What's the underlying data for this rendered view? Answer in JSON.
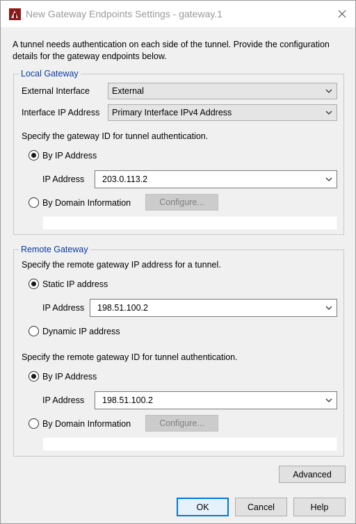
{
  "window": {
    "title": "New Gateway Endpoints Settings - gateway.1",
    "app_icon": "firebox-app-icon",
    "close_icon": "close-icon"
  },
  "intro_text": "A tunnel needs authentication on each side of the tunnel. Provide the configuration details for the gateway endpoints below.",
  "local_gateway": {
    "legend": "Local Gateway",
    "external_interface_label": "External Interface",
    "external_interface_value": "External",
    "interface_ip_label": "Interface IP Address",
    "interface_ip_value": "Primary Interface IPv4 Address",
    "gateway_id_prompt": "Specify the gateway ID for tunnel authentication.",
    "by_ip_label": "By IP Address",
    "by_ip_selected": true,
    "ip_address_label": "IP Address",
    "ip_address_value": "203.0.113.2",
    "by_domain_label": "By Domain Information",
    "by_domain_selected": false,
    "configure_label": "Configure..."
  },
  "remote_gateway": {
    "legend": "Remote Gateway",
    "ip_prompt": "Specify the remote gateway IP address for a tunnel.",
    "static_ip_label": "Static IP address",
    "static_ip_selected": true,
    "ip_address_label": "IP Address",
    "ip_address_value": "198.51.100.2",
    "dynamic_ip_label": "Dynamic IP address",
    "dynamic_ip_selected": false,
    "gateway_id_prompt": "Specify the remote gateway ID for tunnel authentication.",
    "by_ip_label": "By IP Address",
    "by_ip_selected": true,
    "id_ip_address_label": "IP Address",
    "id_ip_address_value": "198.51.100.2",
    "by_domain_label": "By Domain Information",
    "by_domain_selected": false,
    "configure_label": "Configure..."
  },
  "buttons": {
    "advanced": "Advanced",
    "ok": "OK",
    "cancel": "Cancel",
    "help": "Help"
  },
  "colors": {
    "legend": "#0b3aa4",
    "default_button_border": "#0078d7",
    "window_bg": "#f0f0f0"
  }
}
